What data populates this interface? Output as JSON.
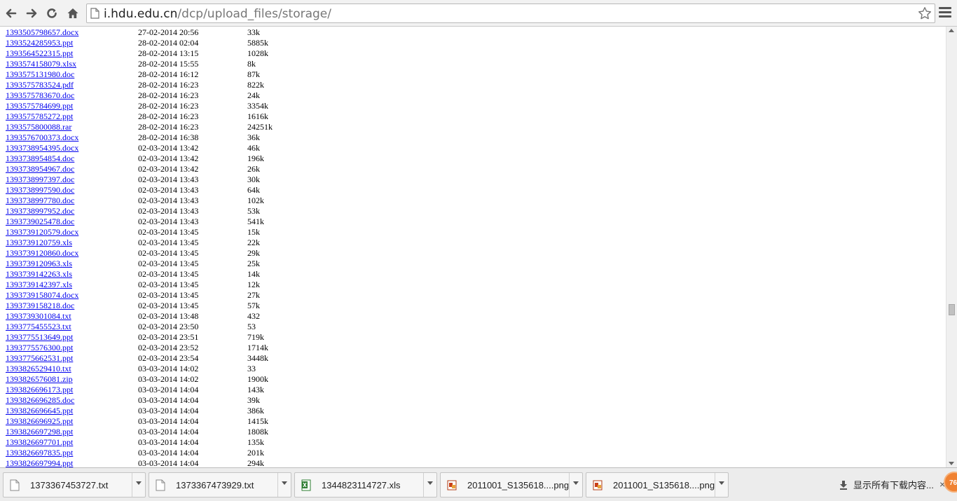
{
  "browser": {
    "url_host": "i.hdu.edu.cn",
    "url_path": "/dcp/upload_files/storage/",
    "icons": {
      "back": "back-arrow-icon",
      "forward": "forward-arrow-icon",
      "reload": "reload-icon",
      "home": "home-icon",
      "page": "page-icon",
      "bookmark": "star-icon",
      "menu": "hamburger-menu-icon"
    }
  },
  "files": [
    {
      "name": "1393505798657.docx",
      "date": "27-02-2014 20:56",
      "size": "33k"
    },
    {
      "name": "1393524285953.ppt",
      "date": "28-02-2014 02:04",
      "size": "5885k"
    },
    {
      "name": "1393564522315.ppt",
      "date": "28-02-2014 13:15",
      "size": "1028k"
    },
    {
      "name": "1393574158079.xlsx",
      "date": "28-02-2014 15:55",
      "size": "8k"
    },
    {
      "name": "1393575131980.doc",
      "date": "28-02-2014 16:12",
      "size": "87k"
    },
    {
      "name": "1393575783524.pdf",
      "date": "28-02-2014 16:23",
      "size": "822k"
    },
    {
      "name": "1393575783670.doc",
      "date": "28-02-2014 16:23",
      "size": "24k"
    },
    {
      "name": "1393575784699.ppt",
      "date": "28-02-2014 16:23",
      "size": "3354k"
    },
    {
      "name": "1393575785272.ppt",
      "date": "28-02-2014 16:23",
      "size": "1616k"
    },
    {
      "name": "1393575800088.rar",
      "date": "28-02-2014 16:23",
      "size": "24251k"
    },
    {
      "name": "1393576700373.docx",
      "date": "28-02-2014 16:38",
      "size": "36k"
    },
    {
      "name": "1393738954395.docx",
      "date": "02-03-2014 13:42",
      "size": "46k"
    },
    {
      "name": "1393738954854.doc",
      "date": "02-03-2014 13:42",
      "size": "196k"
    },
    {
      "name": "1393738954967.doc",
      "date": "02-03-2014 13:42",
      "size": "26k"
    },
    {
      "name": "1393738997397.doc",
      "date": "02-03-2014 13:43",
      "size": "30k"
    },
    {
      "name": "1393738997590.doc",
      "date": "02-03-2014 13:43",
      "size": "64k"
    },
    {
      "name": "1393738997780.doc",
      "date": "02-03-2014 13:43",
      "size": "102k"
    },
    {
      "name": "1393738997952.doc",
      "date": "02-03-2014 13:43",
      "size": "53k"
    },
    {
      "name": "1393739025478.doc",
      "date": "02-03-2014 13:43",
      "size": "541k"
    },
    {
      "name": "1393739120579.docx",
      "date": "02-03-2014 13:45",
      "size": "15k"
    },
    {
      "name": "1393739120759.xls",
      "date": "02-03-2014 13:45",
      "size": "22k"
    },
    {
      "name": "1393739120860.docx",
      "date": "02-03-2014 13:45",
      "size": "29k"
    },
    {
      "name": "1393739120963.xls",
      "date": "02-03-2014 13:45",
      "size": "25k"
    },
    {
      "name": "1393739142263.xls",
      "date": "02-03-2014 13:45",
      "size": "14k"
    },
    {
      "name": "1393739142397.xls",
      "date": "02-03-2014 13:45",
      "size": "12k"
    },
    {
      "name": "1393739158074.docx",
      "date": "02-03-2014 13:45",
      "size": "27k"
    },
    {
      "name": "1393739158218.doc",
      "date": "02-03-2014 13:45",
      "size": "57k"
    },
    {
      "name": "1393739301084.txt",
      "date": "02-03-2014 13:48",
      "size": "432"
    },
    {
      "name": "1393775455523.txt",
      "date": "02-03-2014 23:50",
      "size": "53"
    },
    {
      "name": "1393775513649.ppt",
      "date": "02-03-2014 23:51",
      "size": "719k"
    },
    {
      "name": "1393775576300.ppt",
      "date": "02-03-2014 23:52",
      "size": "1714k"
    },
    {
      "name": "1393775662531.ppt",
      "date": "02-03-2014 23:54",
      "size": "3448k"
    },
    {
      "name": "1393826529410.txt",
      "date": "03-03-2014 14:02",
      "size": "33"
    },
    {
      "name": "1393826576081.zip",
      "date": "03-03-2014 14:02",
      "size": "1900k"
    },
    {
      "name": "1393826696173.ppt",
      "date": "03-03-2014 14:04",
      "size": "143k"
    },
    {
      "name": "1393826696285.doc",
      "date": "03-03-2014 14:04",
      "size": "39k"
    },
    {
      "name": "1393826696645.ppt",
      "date": "03-03-2014 14:04",
      "size": "386k"
    },
    {
      "name": "1393826696925.ppt",
      "date": "03-03-2014 14:04",
      "size": "1415k"
    },
    {
      "name": "1393826697298.ppt",
      "date": "03-03-2014 14:04",
      "size": "1808k"
    },
    {
      "name": "1393826697701.ppt",
      "date": "03-03-2014 14:04",
      "size": "135k"
    },
    {
      "name": "1393826697835.ppt",
      "date": "03-03-2014 14:04",
      "size": "201k"
    },
    {
      "name": "1393826697994.ppt",
      "date": "03-03-2014 14:04",
      "size": "294k"
    }
  ],
  "downloads": [
    {
      "name": "1373367453727.txt",
      "icon": "text-file-icon"
    },
    {
      "name": "1373367473929.txt",
      "icon": "text-file-icon"
    },
    {
      "name": "1344823114727.xls",
      "icon": "excel-file-icon"
    },
    {
      "name": "2011001_S135618....png",
      "icon": "image-file-icon"
    },
    {
      "name": "2011001_S135618....png",
      "icon": "image-file-icon"
    }
  ],
  "shelf": {
    "show_all_label": "显示所有下载内容...",
    "close_label": "×",
    "badge_text": "76"
  },
  "colors": {
    "link": "#0000ee",
    "badge": "#f08232"
  }
}
